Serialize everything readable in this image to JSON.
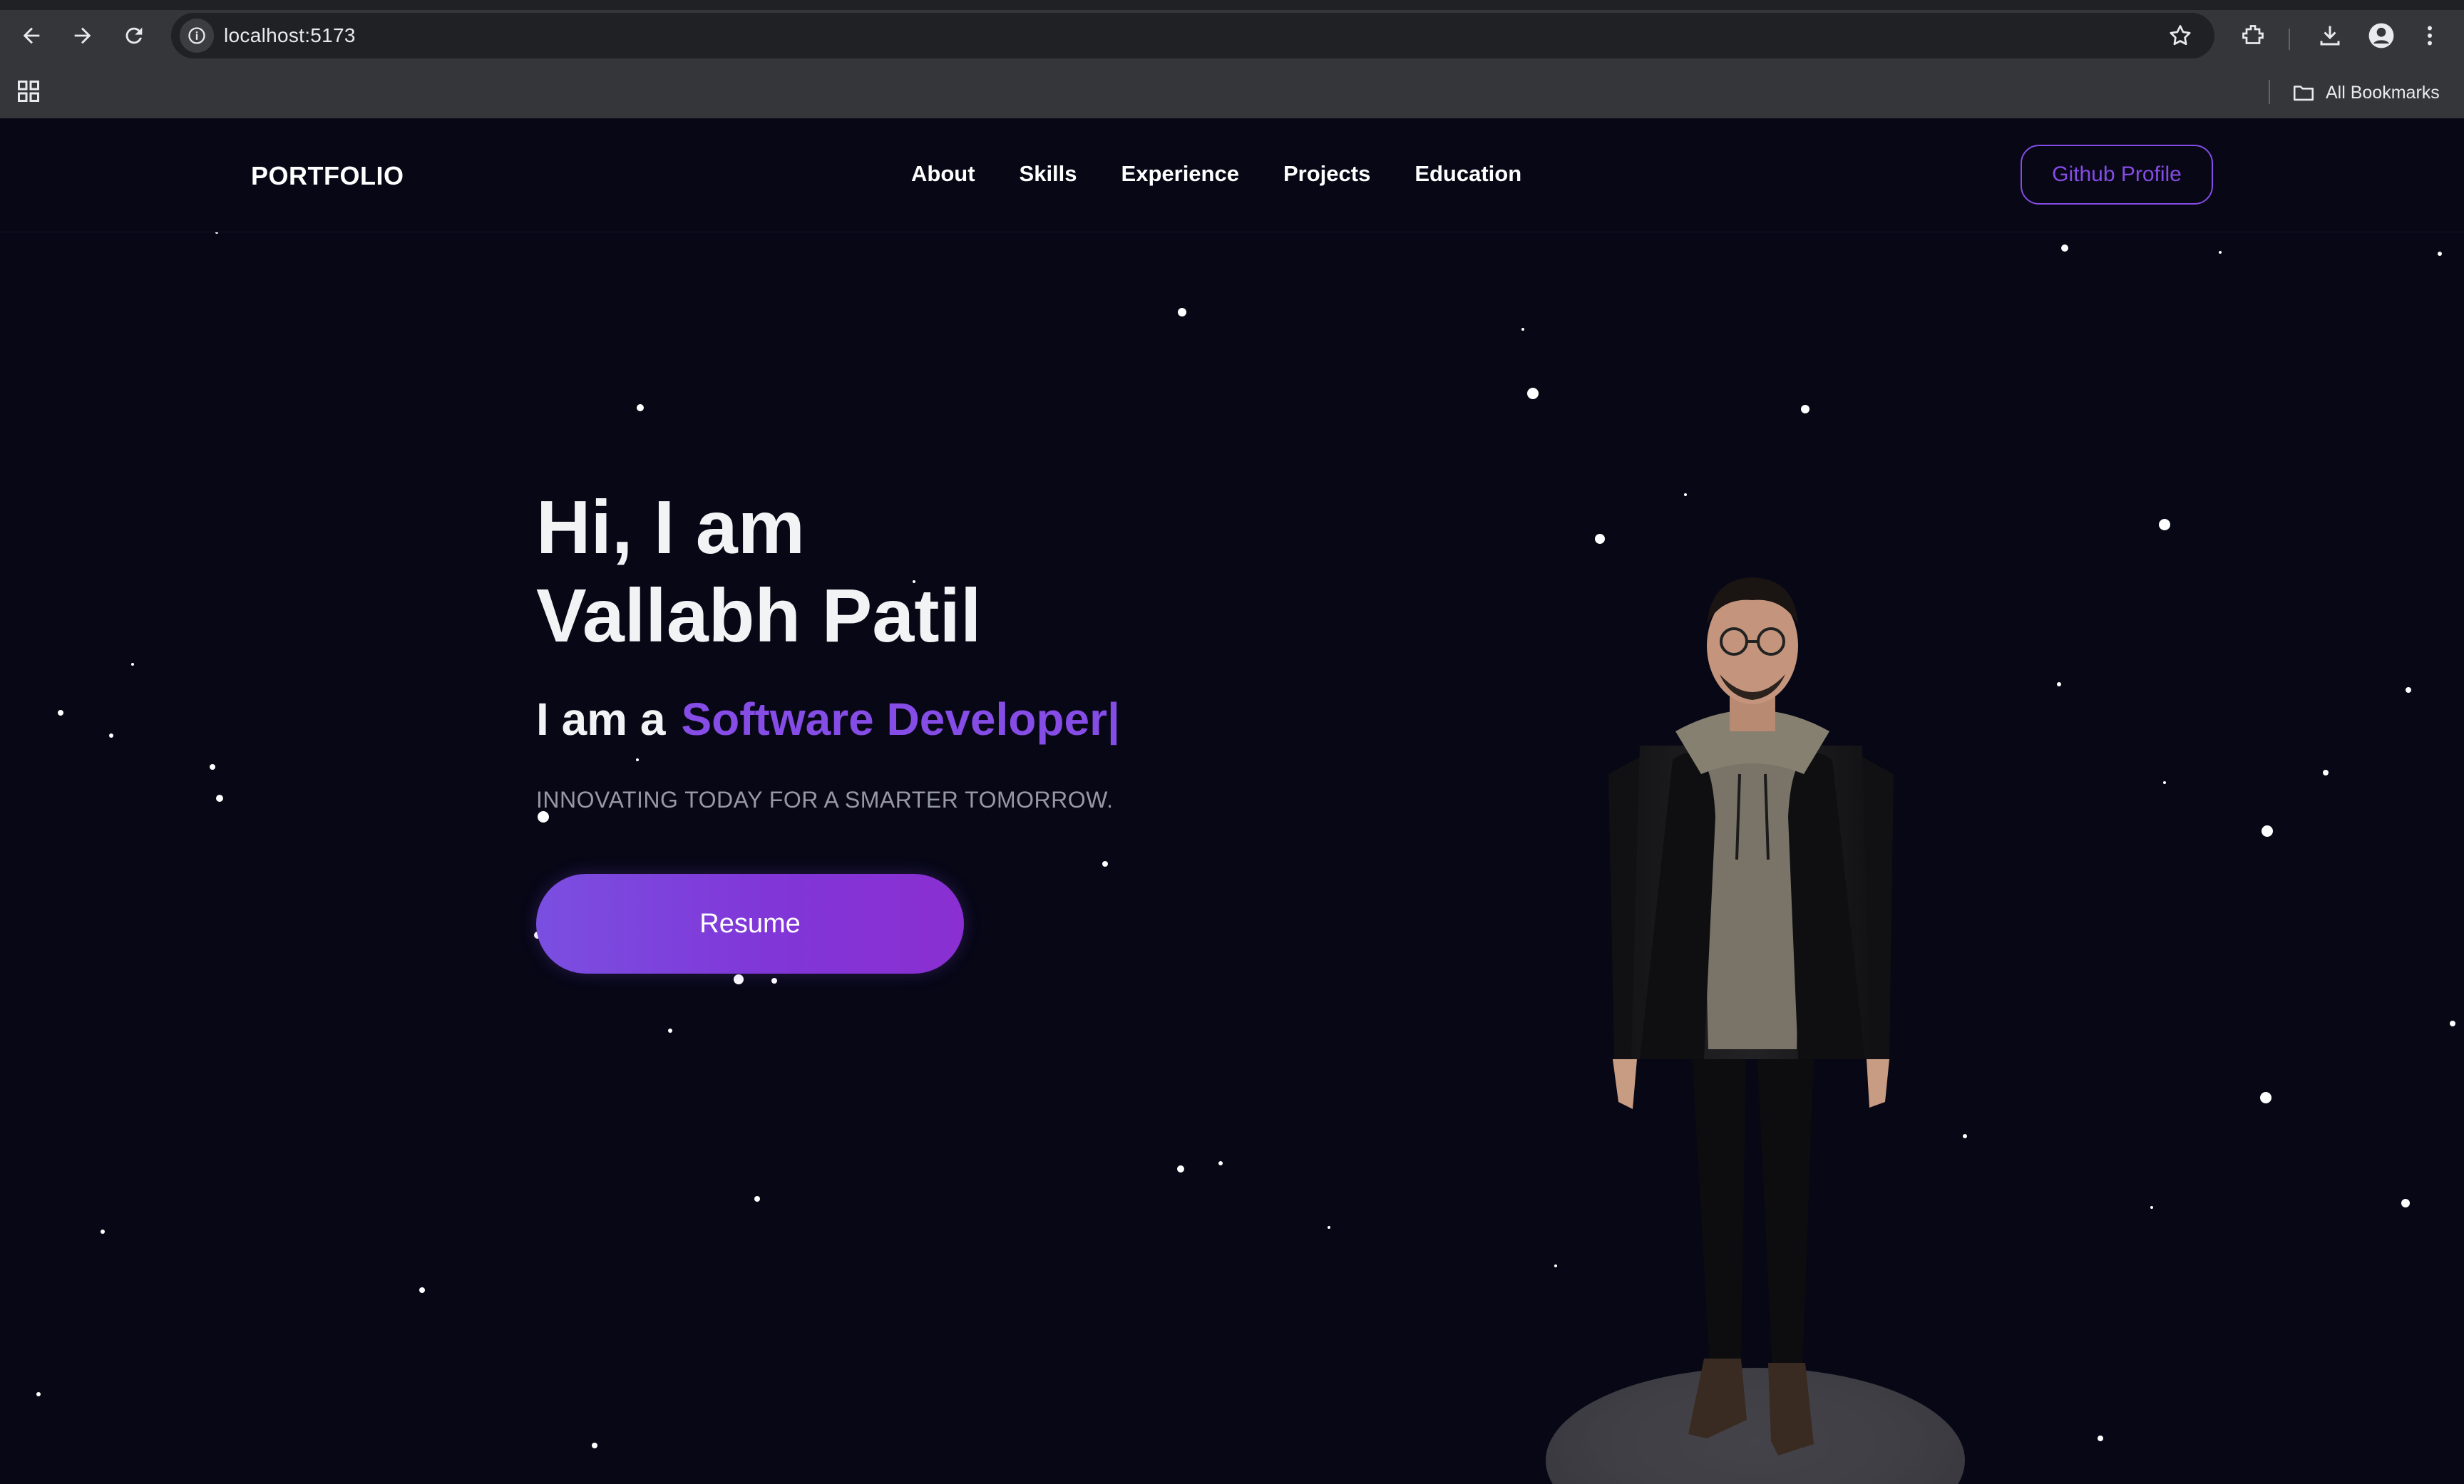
{
  "browser": {
    "url": "localhost:5173",
    "bookmarks_label": "All Bookmarks",
    "icons": [
      "back-icon",
      "forward-icon",
      "reload-icon",
      "site-info-icon",
      "star-icon",
      "extensions-icon",
      "download-icon",
      "profile-icon",
      "menu-icon",
      "apps-icon",
      "folder-icon"
    ]
  },
  "navbar": {
    "logo": "PORTFOLIO",
    "links": [
      "About",
      "Skills",
      "Experience",
      "Projects",
      "Education"
    ],
    "github_label": "Github Profile"
  },
  "hero": {
    "title_line1": "Hi, I am",
    "title_line2": "Vallabh Patil",
    "subtitle_prefix": "I am a",
    "role": "Software Developer",
    "cursor": "|",
    "tagline": "INNOVATING TODAY FOR A SMARTER TOMORROW.",
    "resume_label": "Resume"
  },
  "colors": {
    "background": "#070716",
    "accent": "#854ce6",
    "text_primary": "#f2f3f4",
    "text_secondary": "#9699a5"
  }
}
